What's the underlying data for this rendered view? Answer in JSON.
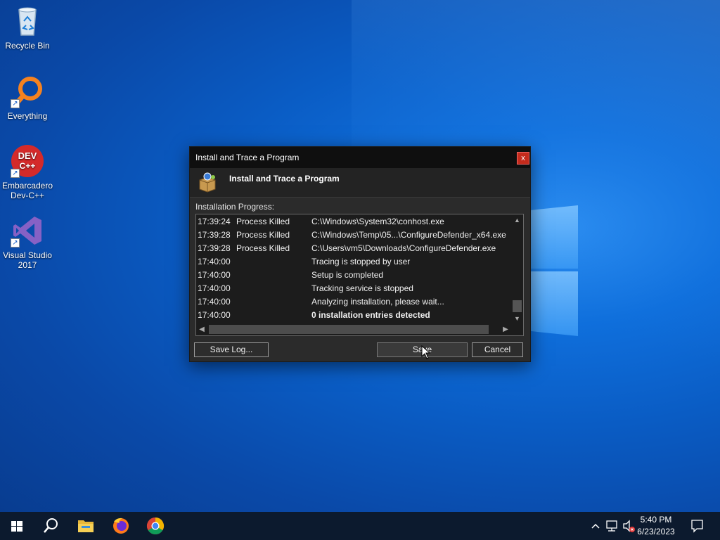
{
  "desktop": {
    "icons": [
      {
        "label": "Recycle Bin"
      },
      {
        "label": "Everything"
      },
      {
        "label": "Embarcadero Dev-C++"
      },
      {
        "label": "Visual Studio 2017"
      }
    ],
    "devcpp_badge": "DEV\nC++"
  },
  "dialog": {
    "window_title": "Install and Trace a Program",
    "close_label": "x",
    "header_title": "Install and Trace a Program",
    "progress_label": "Installation Progress:",
    "log_rows": [
      {
        "time": "17:39:24",
        "action": "Process Killed",
        "detail": "C:\\Windows\\System32\\conhost.exe"
      },
      {
        "time": "17:39:28",
        "action": "Process Killed",
        "detail": "C:\\Windows\\Temp\\05...\\ConfigureDefender_x64.exe"
      },
      {
        "time": "17:39:28",
        "action": "Process Killed",
        "detail": "C:\\Users\\vm5\\Downloads\\ConfigureDefender.exe"
      },
      {
        "time": "17:40:00",
        "action": "",
        "detail": "Tracing is stopped by user"
      },
      {
        "time": "17:40:00",
        "action": "",
        "detail": "Setup is completed"
      },
      {
        "time": "17:40:00",
        "action": "",
        "detail": "Tracking service is stopped"
      },
      {
        "time": "17:40:00",
        "action": "",
        "detail": "Analyzing installation, please wait..."
      },
      {
        "time": "17:40:00",
        "action": "",
        "detail": "0 installation entries detected"
      }
    ],
    "buttons": {
      "save_log": "Save Log...",
      "save": "Save",
      "cancel": "Cancel"
    }
  },
  "taskbar": {
    "icons": [
      "windows-start-icon",
      "search-icon",
      "file-explorer-icon",
      "firefox-icon",
      "chrome-icon"
    ],
    "clock_time": "5:40 PM",
    "clock_date": "6/23/2023"
  },
  "colors": {
    "desktop_blue": "#0a5cc4",
    "dialog_bg": "#2b2b2b",
    "close_red": "#c42b1c",
    "taskbar": "#0c1a2e"
  }
}
